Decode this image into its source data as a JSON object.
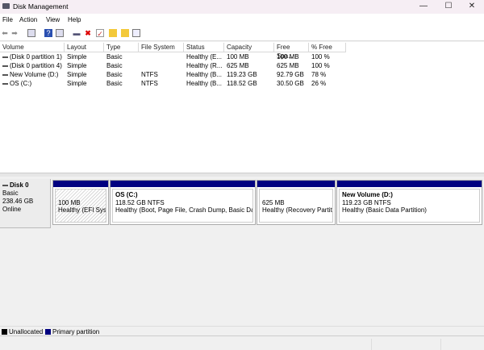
{
  "window": {
    "title": "Disk Management",
    "min": "—",
    "max": "☐",
    "close": "✕"
  },
  "menu": [
    "File",
    "Action",
    "View",
    "Help"
  ],
  "toolbar": [
    "back",
    "forward",
    "console-tree",
    "help",
    "properties",
    "connect",
    "delete",
    "check",
    "folder-up",
    "folder-search",
    "view"
  ],
  "table": {
    "headers": [
      "Volume",
      "Layout",
      "Type",
      "File System",
      "Status",
      "Capacity",
      "Free Spa...",
      "% Free"
    ],
    "rows": [
      [
        "(Disk 0 partition 1)",
        "Simple",
        "Basic",
        "",
        "Healthy (E...",
        "100 MB",
        "100 MB",
        "100 %"
      ],
      [
        "(Disk 0 partition 4)",
        "Simple",
        "Basic",
        "",
        "Healthy (R...",
        "625 MB",
        "625 MB",
        "100 %"
      ],
      [
        "New Volume (D:)",
        "Simple",
        "Basic",
        "NTFS",
        "Healthy (B...",
        "119.23 GB",
        "92.79 GB",
        "78 %"
      ],
      [
        "OS (C:)",
        "Simple",
        "Basic",
        "NTFS",
        "Healthy (B...",
        "118.52 GB",
        "30.50 GB",
        "26 %"
      ]
    ]
  },
  "disk": {
    "name": "Disk 0",
    "type": "Basic",
    "size": "238.46 GB",
    "state": "Online",
    "partitions": [
      {
        "title": "",
        "size": "100 MB",
        "status": "Healthy (EFI System Partition)"
      },
      {
        "title": "OS  (C:)",
        "size": "118.52 GB NTFS",
        "status": "Healthy (Boot, Page File, Crash Dump, Basic Data Partition)"
      },
      {
        "title": "",
        "size": "625 MB",
        "status": "Healthy (Recovery Partition)"
      },
      {
        "title": "New Volume  (D:)",
        "size": "119.23 GB NTFS",
        "status": "Healthy (Basic Data Partition)"
      }
    ]
  },
  "legend": [
    {
      "label": "Unallocated",
      "color": "#000000"
    },
    {
      "label": "Primary partition",
      "color": "#000080"
    }
  ]
}
